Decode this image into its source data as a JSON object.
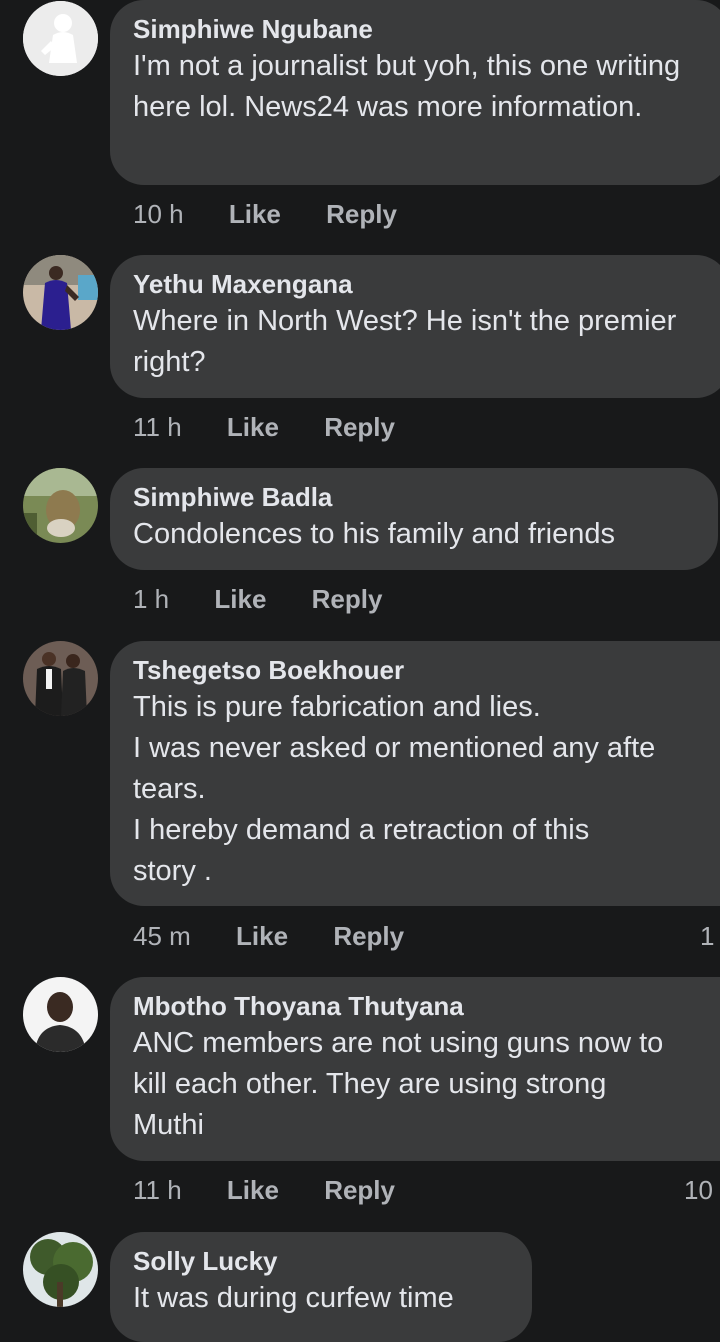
{
  "comments": [
    {
      "author": "Simphiwe Ngubane",
      "text": "I'm not a journalist but yoh, this one writing here lol. News24 was more information.",
      "time": "10 h",
      "like": "Like",
      "reply": "Reply",
      "avatar": "default-profile-silhouette"
    },
    {
      "author": "Yethu Maxengana",
      "text": "Where in North West? He isn't the premier right?",
      "time": "11 h",
      "like": "Like",
      "reply": "Reply",
      "avatar": "woman-in-blue-dress-photo"
    },
    {
      "author": "Simphiwe Badla",
      "text": "Condolences to his family and friends",
      "time": "1 h",
      "like": "Like",
      "reply": "Reply",
      "avatar": "painted-portrait-photo"
    },
    {
      "author": "Tshegetso Boekhouer",
      "text": "This is pure fabrication and lies.\nI was never asked or mentioned any afte\ntears.\nI hereby demand a retraction of this\nstory .",
      "time": "45 m",
      "like": "Like",
      "reply": "Reply",
      "reactions": "1",
      "avatar": "couple-photo"
    },
    {
      "author": "Mbotho Thoyana Thutyana",
      "text": "ANC members are not using guns now to\nkill each other. They are using strong\nMuthi",
      "time": "11 h",
      "like": "Like",
      "reply": "Reply",
      "reactions": "10",
      "avatar": "man-portrait-photo"
    },
    {
      "author": "Solly Lucky",
      "text": "It was during curfew time",
      "avatar": "tree-photo"
    }
  ],
  "colors": {
    "background": "#18191a",
    "bubble": "#3a3b3c",
    "text": "#e4e6eb",
    "secondary_text": "#b0b3b8"
  }
}
